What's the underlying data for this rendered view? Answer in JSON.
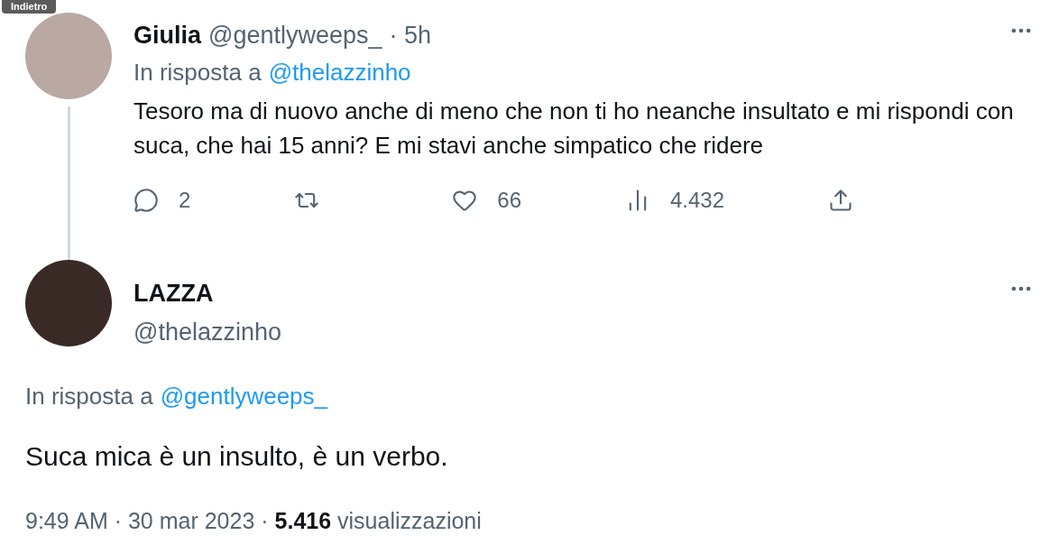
{
  "tooltip": {
    "label": "Indietro"
  },
  "reply_tweet": {
    "name": "Giulia",
    "handle": "@gentlyweeps_",
    "time": "· 5h",
    "reply_prefix": "In risposta a",
    "reply_to": "@thelazzinho",
    "text": "Tesoro ma di nuovo anche di meno che non ti ho neanche insultato e mi rispondi con suca, che hai 15 anni? E mi stavi anche simpatico che ridere",
    "actions": [
      {
        "kind": "reply",
        "count": "2"
      },
      {
        "kind": "retweet"
      },
      {
        "kind": "like",
        "count": "66"
      },
      {
        "kind": "views",
        "count": "4.432"
      },
      {
        "kind": "share"
      }
    ]
  },
  "main_tweet": {
    "name": "LAZZA",
    "handle": "@thelazzinho",
    "reply_prefix": "In risposta a",
    "reply_to": "@gentlyweeps_",
    "text": "Suca mica è un insulto, è un verbo.",
    "meta": "9:49 AM · 30 mar 2023 · **5.416** visualizzazioni"
  }
}
